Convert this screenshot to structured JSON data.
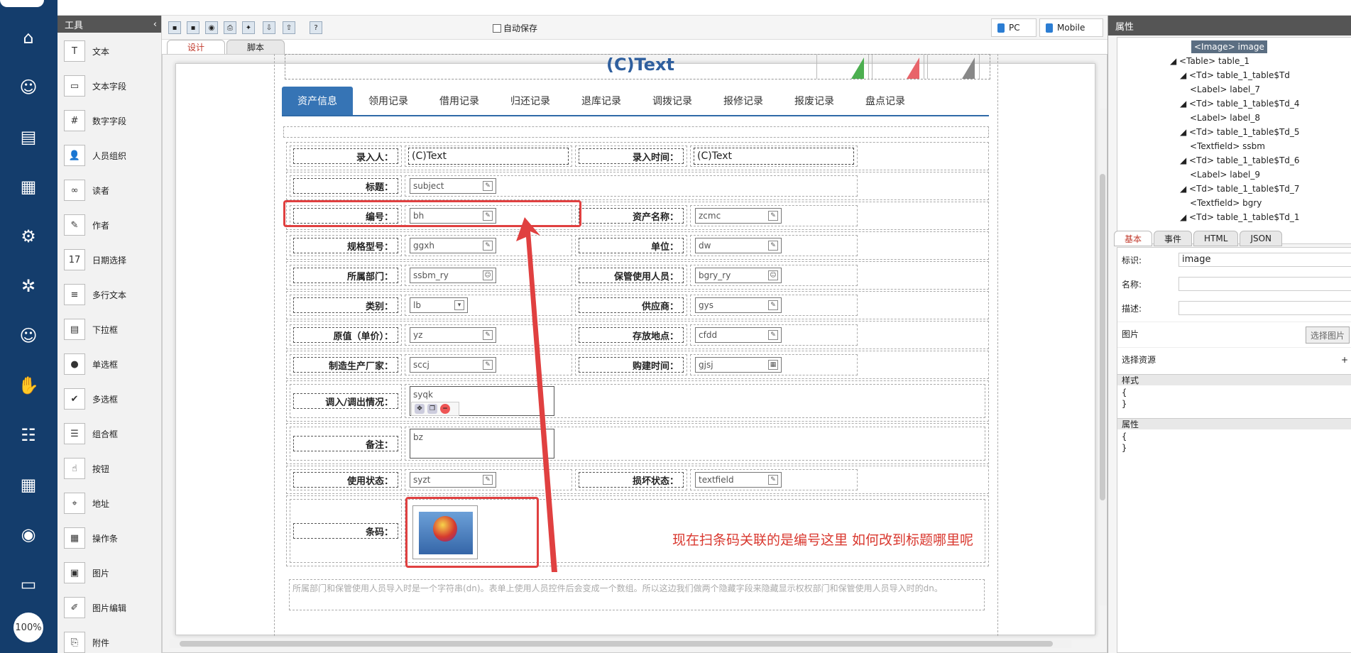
{
  "rail": {
    "icons": [
      "home-icon",
      "user-card-icon",
      "news-icon",
      "calendar-icon",
      "user-settings-icon",
      "gear-icon",
      "user-card-icon-2",
      "handshake-icon",
      "team-icon",
      "calendar-icon-2",
      "monitor-icon",
      "folder-icon"
    ],
    "zoom": "100%"
  },
  "tools": {
    "title": "工具",
    "items": [
      {
        "label": "文本",
        "glyph": "T"
      },
      {
        "label": "文本字段",
        "glyph": "▭"
      },
      {
        "label": "数字字段",
        "glyph": "#"
      },
      {
        "label": "人员组织",
        "glyph": "👤"
      },
      {
        "label": "读者",
        "glyph": "∞"
      },
      {
        "label": "作者",
        "glyph": "✎"
      },
      {
        "label": "日期选择",
        "glyph": "17"
      },
      {
        "label": "多行文本",
        "glyph": "≡"
      },
      {
        "label": "下拉框",
        "glyph": "▤"
      },
      {
        "label": "单选框",
        "glyph": "●"
      },
      {
        "label": "多选框",
        "glyph": "✔"
      },
      {
        "label": "组合框",
        "glyph": "☰"
      },
      {
        "label": "按钮",
        "glyph": "☝"
      },
      {
        "label": "地址",
        "glyph": "⌖"
      },
      {
        "label": "操作条",
        "glyph": "▦"
      },
      {
        "label": "图片",
        "glyph": "▣"
      },
      {
        "label": "图片编辑",
        "glyph": "✐"
      },
      {
        "label": "附件",
        "glyph": "⎘"
      }
    ]
  },
  "toolbar": {
    "autosave": "自动保存",
    "pc": "PC",
    "mobile": "Mobile"
  },
  "editor_tabs": [
    "设计",
    "脚本"
  ],
  "form": {
    "header_text": "(C)Text",
    "tabs": [
      "资产信息",
      "领用记录",
      "借用记录",
      "归还记录",
      "退库记录",
      "调拨记录",
      "报修记录",
      "报废记录",
      "盘点记录"
    ],
    "rows": {
      "r1": {
        "l1": "录入人：",
        "v1": "(C)Text",
        "l2": "录入时间：",
        "v2": "(C)Text"
      },
      "r2": {
        "l1": "标题：",
        "v1": "subject"
      },
      "r3": {
        "l1": "编号：",
        "v1": "bh",
        "l2": "资产名称：",
        "v2": "zcmc"
      },
      "r4": {
        "l1": "规格型号：",
        "v1": "ggxh",
        "l2": "单位：",
        "v2": "dw"
      },
      "r5": {
        "l1": "所属部门：",
        "v1": "ssbm_ry",
        "l2": "保管使用人员：",
        "v2": "bgry_ry"
      },
      "r6": {
        "l1": "类别：",
        "v1": "lb",
        "l2": "供应商：",
        "v2": "gys"
      },
      "r7": {
        "l1": "原值（单价）：",
        "v1": "yz",
        "l2": "存放地点：",
        "v2": "cfdd"
      },
      "r8": {
        "l1": "制造生产厂家：",
        "v1": "sccj",
        "l2": "购建时间：",
        "v2": "gjsj"
      },
      "r9": {
        "l1": "调入/调出情况：",
        "v1": "syqk"
      },
      "r10": {
        "l1": "备注：",
        "v1": "bz"
      },
      "r11": {
        "l1": "使用状态：",
        "v1": "syzt",
        "l2": "损坏状态：",
        "v2": "textfield"
      },
      "r12": {
        "l1": "条码："
      }
    },
    "note": "所属部门和保管使用人员导入时是一个字符串(dn)。表单上使用人员控件后会变成一个数组。所以这边我们做两个隐藏字段来隐藏显示权权部门和保管使用人员导入时的dn。"
  },
  "annotation": {
    "text": "现在扫条码关联的是编号这里 如何改到标题哪里呢",
    "color": "#e04040"
  },
  "props": {
    "title": "属性",
    "tree": [
      {
        "t": "<Image> image",
        "indent": 0,
        "sel": true
      },
      {
        "t": "◢ <Table> table_1",
        "indent": 1
      },
      {
        "t": "◢ <Td> table_1_table$Td",
        "indent": 2
      },
      {
        "t": "<Label> label_7",
        "indent": 3
      },
      {
        "t": "◢ <Td> table_1_table$Td_4",
        "indent": 2
      },
      {
        "t": "<Label> label_8",
        "indent": 3
      },
      {
        "t": "◢ <Td> table_1_table$Td_5",
        "indent": 2
      },
      {
        "t": "<Textfield> ssbm",
        "indent": 3
      },
      {
        "t": "◢ <Td> table_1_table$Td_6",
        "indent": 2
      },
      {
        "t": "<Label> label_9",
        "indent": 3
      },
      {
        "t": "◢ <Td> table_1_table$Td_7",
        "indent": 2
      },
      {
        "t": "<Textfield> bgry",
        "indent": 3
      },
      {
        "t": "◢ <Td> table_1_table$Td_1",
        "indent": 2
      }
    ],
    "tabs": [
      "基本",
      "事件",
      "HTML",
      "JSON"
    ],
    "id_label": "标识:",
    "id_value": "image",
    "name_label": "名称:",
    "desc_label": "描述:",
    "pic_label": "图片",
    "pic_button": "选择图片",
    "res_label": "选择资源",
    "res_plus": "+",
    "style_label": "样式",
    "style_code": "{\n}",
    "attr_label": "属性",
    "attr_code": "{\n}"
  }
}
